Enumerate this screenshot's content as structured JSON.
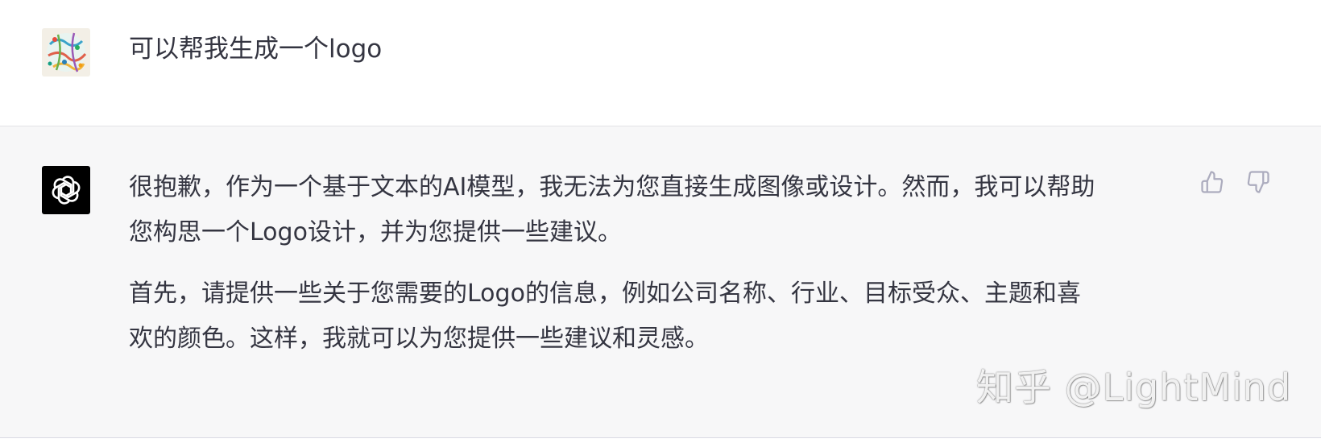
{
  "user": {
    "avatar_icon": "colorful-map-avatar-icon",
    "message": "可以帮我生成一个logo"
  },
  "assistant": {
    "avatar_icon": "openai-logo-icon",
    "paragraphs": [
      {
        "lines": [
          "很抱歉，作为一个基于文本的AI模型，我无法为您直接生成图像或设计。然而，我可以帮助",
          "您构思一个Logo设计，并为您提供一些建议。"
        ]
      },
      {
        "lines": [
          "首先，请提供一些关于您需要的Logo的信息，例如公司名称、行业、目标受众、主题和喜",
          "欢的颜色。这样，我就可以为您提供一些建议和灵感。"
        ]
      }
    ],
    "feedback": {
      "up_icon": "thumbs-up-icon",
      "down_icon": "thumbs-down-icon"
    }
  },
  "watermark": "知乎 @LightMind",
  "colors": {
    "text": "#343541",
    "assistant_bg": "#f7f7f8",
    "user_bg": "#ffffff",
    "icon_gray": "#acacbe"
  }
}
